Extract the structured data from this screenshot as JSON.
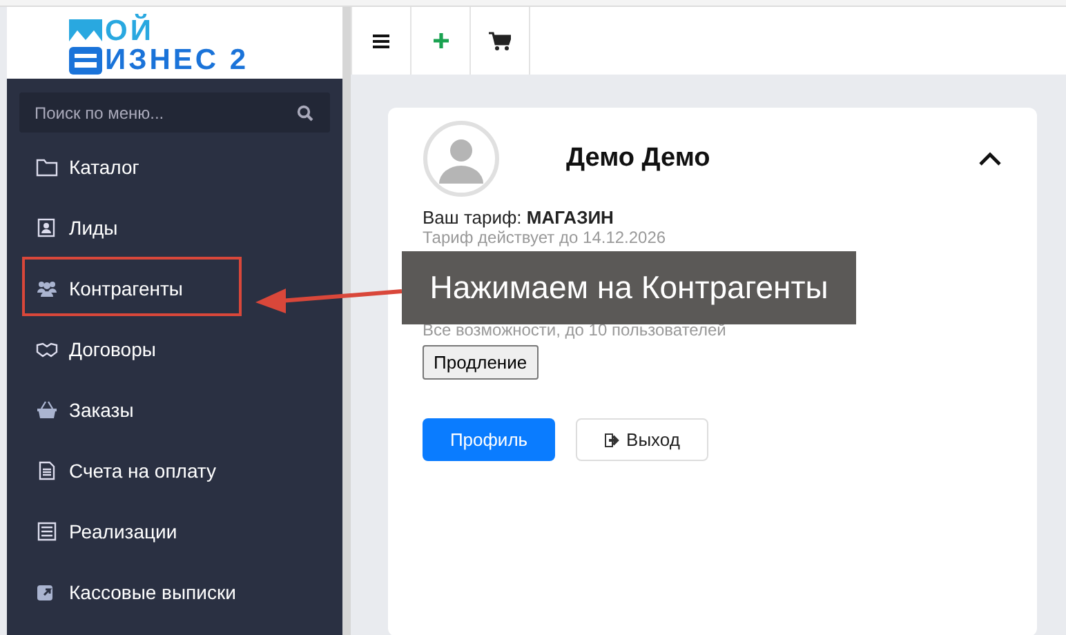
{
  "logo": {
    "line1": "ОЙ",
    "line2": "ИЗНЕС 2"
  },
  "sidebar": {
    "search": {
      "placeholder": "Поиск по меню..."
    },
    "items": [
      {
        "label": "Каталог",
        "highlighted": false
      },
      {
        "label": "Лиды",
        "highlighted": false
      },
      {
        "label": "Контрагенты",
        "highlighted": true
      },
      {
        "label": "Договоры",
        "highlighted": false
      },
      {
        "label": "Заказы",
        "highlighted": false
      },
      {
        "label": "Счета на оплату",
        "highlighted": false
      },
      {
        "label": "Реализации",
        "highlighted": false
      },
      {
        "label": "Кассовые выписки",
        "highlighted": false
      }
    ]
  },
  "profile": {
    "name": "Демо Демо",
    "tariff_label": "Ваш тариф:",
    "tariff": "МАГАЗИН",
    "details": [
      "Тариф действует до 14.12.2026"
    ],
    "description": "Все возможности, до 10 пользователей",
    "renew_button": "Продление",
    "profile_button": "Профиль",
    "logout_button": "Выход"
  },
  "annotation": {
    "text": "Нажимаем на Контрагенты"
  }
}
